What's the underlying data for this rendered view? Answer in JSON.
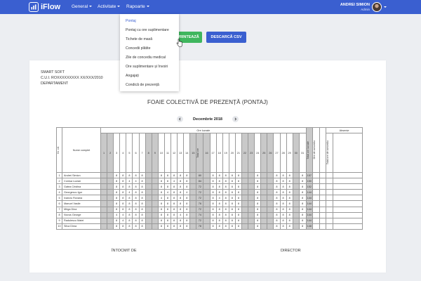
{
  "app": {
    "logo_text": "iFlow",
    "accent": "#3a5fd0",
    "logo_icon": "chart-bars-icon"
  },
  "nav": {
    "items": [
      {
        "label": "General"
      },
      {
        "label": "Activitate"
      },
      {
        "label": "Rapoarte"
      }
    ]
  },
  "user": {
    "name": "ANDREI SIMION",
    "role": "Admin",
    "avatar_icon": "avatar"
  },
  "dropdown": {
    "items": [
      {
        "label": "Pontaj",
        "active": true
      },
      {
        "label": "Pontaj cu ore suplimentare"
      },
      {
        "label": "Tichete de masă"
      },
      {
        "label": "Concedii plătite"
      },
      {
        "label": "Zile de concediu medical"
      },
      {
        "label": "Ore suplimentare și învoiri"
      },
      {
        "label": "Angajați"
      },
      {
        "label": "Condică de prezență"
      }
    ]
  },
  "buttons": {
    "print_label": "PRINTEAZĂ",
    "csv_label": "DESCARCĂ CSV",
    "print_color": "#3fb65e",
    "csv_color": "#3a5fd0"
  },
  "company": {
    "name": "SMART SOFT",
    "cui": "C.U.I. ROXXXXXXXXX XX/XXX/2010",
    "department": "DEPARTAMENT"
  },
  "report": {
    "title": "FOAIE COLECTIVĂ DE PREZENȚĂ (PONTAJ)",
    "month": "Decembrie 2018",
    "prev_icon": "chevron-left-icon",
    "next_icon": "chevron-right-icon"
  },
  "table": {
    "header_nr": "Nr. crt.",
    "header_name": "Nume complet",
    "header_hours_group": "Ore lucrate",
    "header_total_label": "Total ore",
    "header_worked_total": "Total ore lucrate",
    "header_holiday": "Ore de concediu",
    "header_absences": "Absențe",
    "header_leave": "Total ore de concediu",
    "days": [
      "1",
      "2",
      "3",
      "4",
      "5",
      "6",
      "7",
      "8",
      "9",
      "10",
      "11",
      "12",
      "13",
      "14",
      "15",
      "16",
      "17",
      "18",
      "19",
      "20",
      "21",
      "22",
      "23",
      "24",
      "25",
      "26",
      "27",
      "28",
      "29",
      "30",
      "31"
    ],
    "rows": [
      {
        "nr": "1",
        "name": "Andrei Simion",
        "h": [
          "",
          "",
          "8",
          "8",
          "8",
          "8",
          "8",
          "",
          "",
          "8",
          "8",
          "8",
          "8",
          "8",
          "",
          "",
          "8",
          "8",
          "8",
          "8",
          "8",
          "",
          "",
          "8",
          "",
          "",
          "8",
          "8",
          "8",
          "",
          "8"
        ],
        "half": "80",
        "total": "157"
      },
      {
        "nr": "2",
        "name": "Comșa Lucian",
        "h": [
          "",
          "",
          "8",
          "8",
          "4",
          "4",
          "8",
          "",
          "",
          "8",
          "8",
          "4",
          "8",
          "8",
          "",
          "",
          "8",
          "8",
          "8",
          "8",
          "8",
          "",
          "",
          "8",
          "",
          "",
          "8",
          "8",
          "8",
          "",
          "8"
        ],
        "half": "84",
        "total": "150"
      },
      {
        "nr": "3",
        "name": "Gatea Cristina",
        "h": [
          "",
          "",
          "8",
          "8",
          "8",
          "8",
          "8",
          "",
          "",
          "8",
          "8",
          "8",
          "8",
          "8",
          "",
          "",
          "8",
          "8",
          "8",
          "8",
          "8",
          "",
          "",
          "8",
          "",
          "",
          "8",
          "8",
          "8",
          "",
          "8"
        ],
        "half": "72",
        "total": "152"
      },
      {
        "nr": "4",
        "name": "Georgescu Igor",
        "h": [
          "",
          "",
          "8",
          "8",
          "4",
          "8",
          "8",
          "",
          "",
          "8",
          "4",
          "8",
          "8",
          "4",
          "",
          "",
          "8",
          "8",
          "8",
          "8",
          "8",
          "",
          "",
          "8",
          "",
          "",
          "8",
          "8",
          "8",
          "",
          "8"
        ],
        "half": "72",
        "total": "144"
      },
      {
        "nr": "5",
        "name": "Ivanciu Roxana",
        "h": [
          "",
          "",
          "8",
          "8",
          "8",
          "8",
          "8",
          "",
          "",
          "4",
          "8",
          "8",
          "8",
          "8",
          "",
          "",
          "8",
          "4",
          "8",
          "8",
          "8",
          "",
          "",
          "8",
          "",
          "",
          "8",
          "8",
          "8",
          "",
          "8"
        ],
        "half": "72",
        "total": "144"
      },
      {
        "nr": "6",
        "name": "Manuel Vasile",
        "h": [
          "",
          "",
          "8",
          "8",
          "8",
          "8",
          "8",
          "",
          "",
          "8",
          "8",
          "8",
          "8",
          "8",
          "",
          "",
          "8",
          "8",
          "8",
          "8",
          "8",
          "",
          "",
          "8",
          "",
          "",
          "8",
          "8",
          "8",
          "",
          "8"
        ],
        "half": "76",
        "total": "144"
      },
      {
        "nr": "7",
        "name": "Mirga Dina",
        "h": [
          "",
          "",
          "8",
          "8",
          "8",
          "8",
          "8",
          "",
          "",
          "8",
          "8",
          "8",
          "8",
          "8",
          "",
          "",
          "8",
          "8",
          "8",
          "8",
          "8",
          "",
          "",
          "8",
          "",
          "",
          "8",
          "8",
          "8",
          "",
          "8"
        ],
        "half": "72",
        "total": "144"
      },
      {
        "nr": "8",
        "name": "Novus George",
        "h": [
          "",
          "",
          "4",
          "4",
          "8",
          "8",
          "8",
          "",
          "",
          "8",
          "8",
          "8",
          "4",
          "8",
          "",
          "",
          "8",
          "8",
          "8",
          "8",
          "8",
          "",
          "",
          "8",
          "",
          "",
          "8",
          "8",
          "8",
          "",
          "8"
        ],
        "half": "74",
        "total": "144"
      },
      {
        "nr": "9",
        "name": "Radulescu Matei",
        "h": [
          "",
          "",
          "8",
          "4",
          "8",
          "8",
          "8",
          "",
          "",
          "8",
          "8",
          "8",
          "8",
          "8",
          "",
          "",
          "8",
          "8",
          "8",
          "8",
          "8",
          "",
          "",
          "8",
          "",
          "",
          "8",
          "8",
          "8",
          "",
          "8"
        ],
        "half": "72",
        "total": "144"
      },
      {
        "nr": "10",
        "name": "Silva Dima",
        "h": [
          "",
          "",
          "8",
          "8",
          "8",
          "8",
          "8",
          "",
          "",
          "8",
          "8",
          "8",
          "8",
          "8",
          "",
          "",
          "8",
          "8",
          "8",
          "8",
          "8",
          "",
          "",
          "8",
          "",
          "",
          "8",
          "8",
          "8",
          "",
          "8"
        ],
        "half": "78",
        "total": "148"
      }
    ]
  },
  "signatures": {
    "left": "ÎNTOCMIT DE",
    "right": "DIRECTOR"
  }
}
